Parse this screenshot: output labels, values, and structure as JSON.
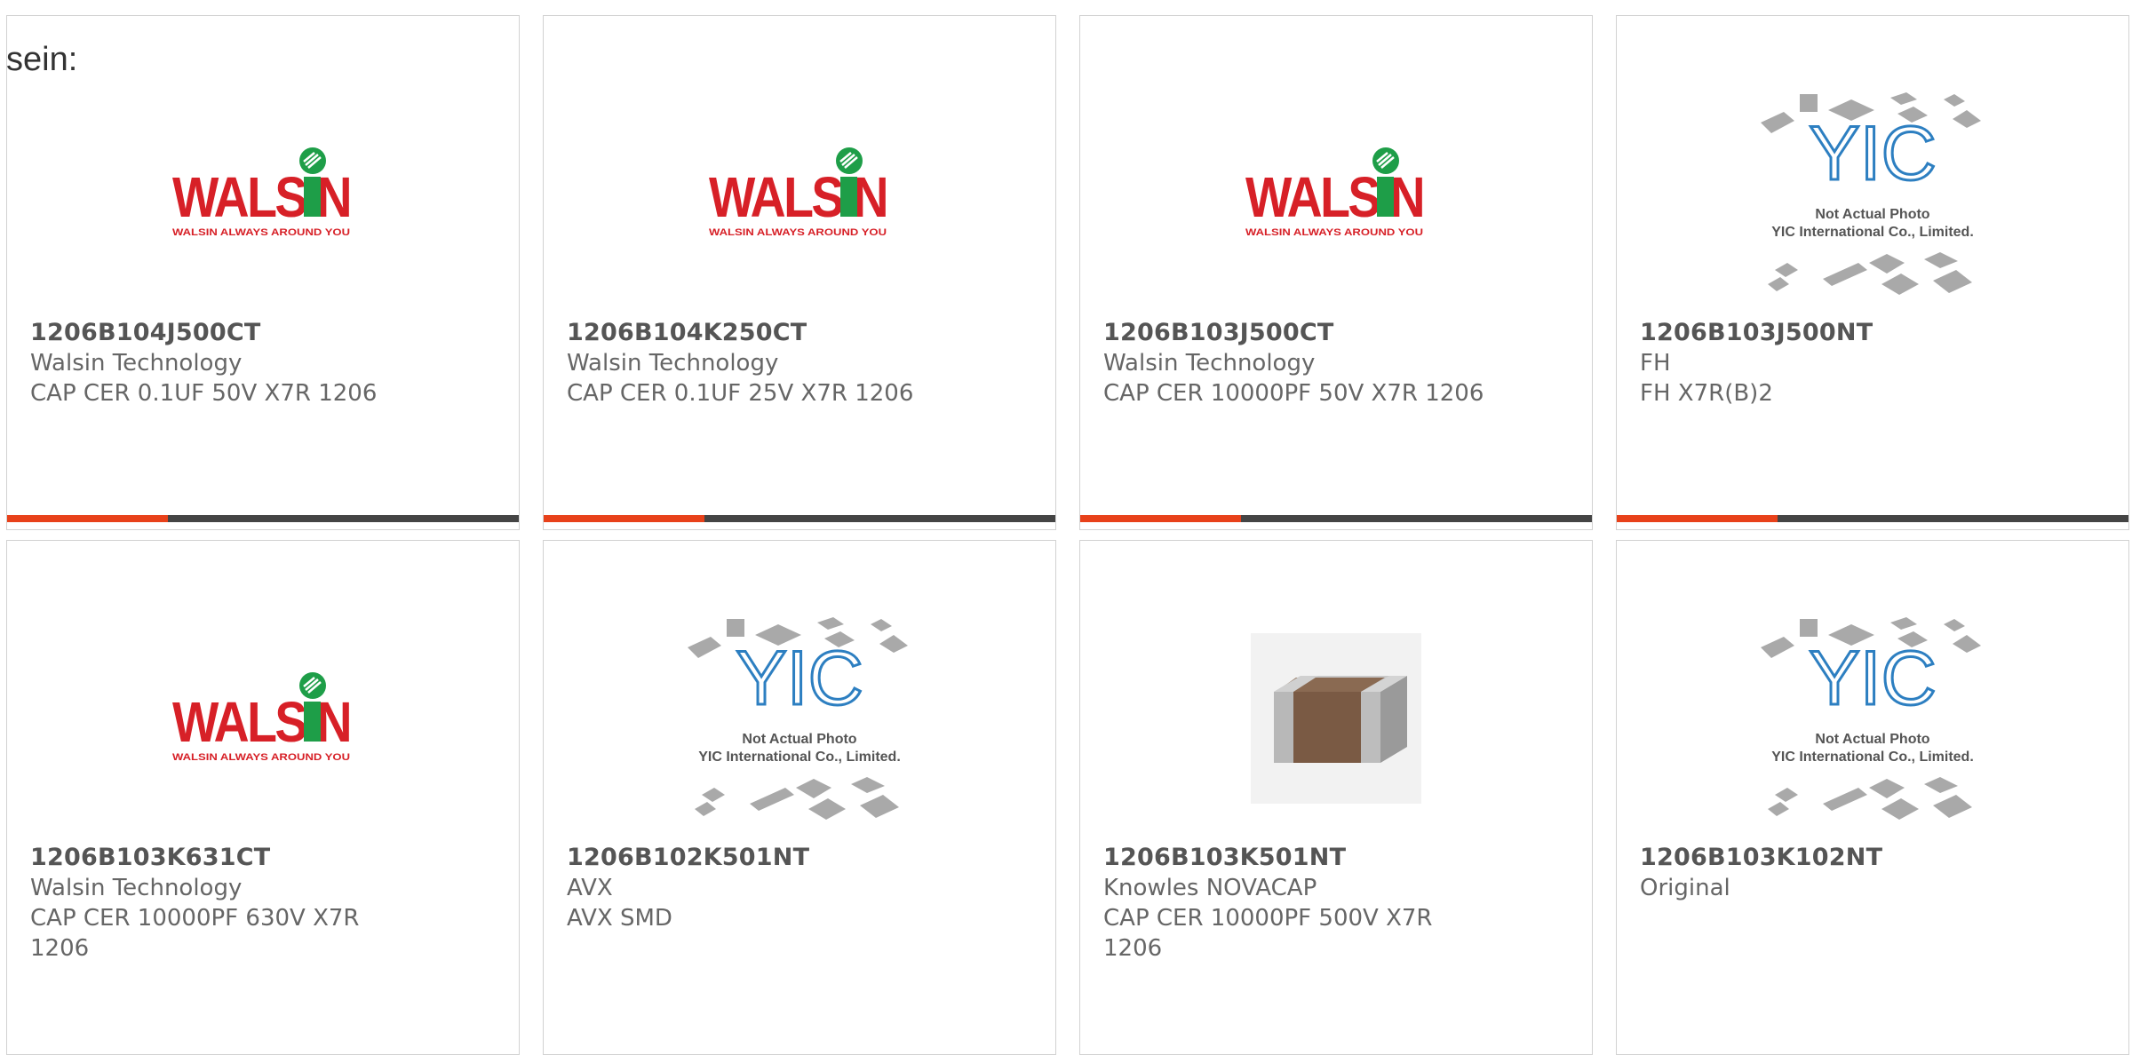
{
  "intro_text": "sein:",
  "colors": {
    "accent_bar": "#e8411a",
    "bar_dark": "#444444",
    "walsin_red": "#d72027",
    "walsin_green": "#1e9e48",
    "yic_blue": "#2d7fc1"
  },
  "logos": {
    "walsin": {
      "wordmark": "WALSIN",
      "tagline": "WALSIN ALWAYS AROUND YOU"
    },
    "yic": {
      "letters": "YIC",
      "line1": "Not Actual Photo",
      "line2": "YIC International Co., Limited."
    }
  },
  "products": [
    {
      "part_number": "1206B104J500CT",
      "manufacturer": "Walsin Technology",
      "description": "CAP CER 0.1UF 50V X7R 1206",
      "image": "walsin-logo"
    },
    {
      "part_number": "1206B104K250CT",
      "manufacturer": "Walsin Technology",
      "description": "CAP CER 0.1UF 25V X7R 1206",
      "image": "walsin-logo"
    },
    {
      "part_number": "1206B103J500CT",
      "manufacturer": "Walsin Technology",
      "description": "CAP CER 10000PF 50V X7R 1206",
      "image": "walsin-logo"
    },
    {
      "part_number": "1206B103J500NT",
      "manufacturer": "FH",
      "description": "FH X7R(B)2",
      "image": "yic-placeholder"
    },
    {
      "part_number": "1206B103K631CT",
      "manufacturer": "Walsin Technology",
      "description": "CAP CER 10000PF 630V X7R",
      "description_2": "1206",
      "image": "walsin-logo"
    },
    {
      "part_number": "1206B102K501NT",
      "manufacturer": "AVX",
      "description": "AVX SMD",
      "image": "yic-placeholder"
    },
    {
      "part_number": "1206B103K501NT",
      "manufacturer": "Knowles NOVACAP",
      "description": "CAP CER 10000PF 500V X7R",
      "description_2": "1206",
      "image": "capacitor-photo"
    },
    {
      "part_number": "1206B103K102NT",
      "manufacturer": "Original",
      "description": "",
      "image": "yic-placeholder"
    }
  ]
}
